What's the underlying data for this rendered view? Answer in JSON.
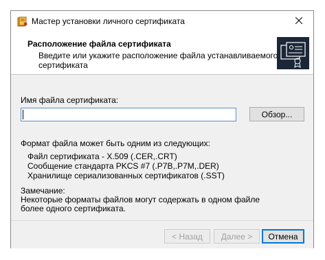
{
  "window": {
    "title": "Мастер установки личного сертификата"
  },
  "header": {
    "title": "Расположение файла сертификата",
    "subtitle": "Введите или укажите расположение файла устанавливаемого сертификата"
  },
  "form": {
    "file_label": "Имя файла сертификата:",
    "file_value": "",
    "browse_label": "Обзор..."
  },
  "formats": {
    "intro": "Формат файла может быть одним из следующих:",
    "items": [
      "Файл сертификата - X.509 (.CER,.CRT)",
      "Сообщение стандарта PKCS #7 (.P7B,.P7M,.DER)",
      "Хранилище сериализованных сертификатов (.SST)"
    ]
  },
  "note": {
    "title": "Замечание:",
    "lines": [
      "Некоторые форматы файлов могут содержать в одном файле",
      "более одного сертификата."
    ]
  },
  "buttons": {
    "back": "< Назад",
    "next": "Далее >",
    "cancel": "Отмена"
  },
  "colors": {
    "dialog_bg": "#f0f0f0",
    "accent": "#0078d7",
    "disabled_text": "#a0a0a0"
  },
  "icons": {
    "app": "certificate-app-icon",
    "close": "close-icon",
    "header": "certificate-wizard-icon"
  }
}
